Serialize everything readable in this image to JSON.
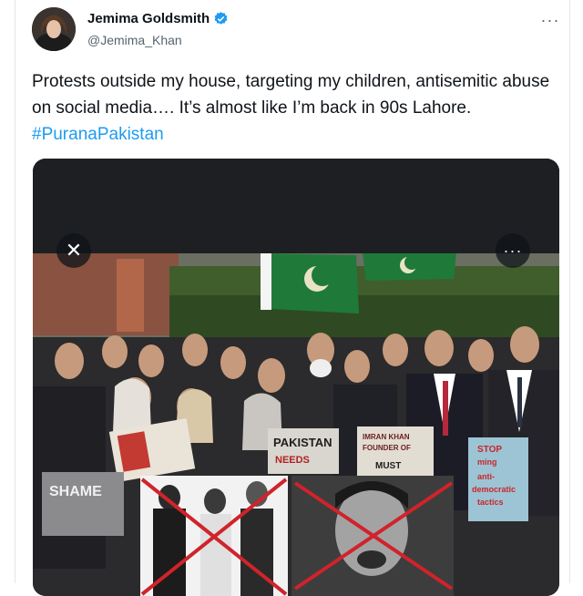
{
  "tweet": {
    "display_name": "Jemima Goldsmith",
    "handle": "@Jemima_Khan",
    "text_main": "Protests outside my house, targeting my children, antisemitic abuse on social media…. It’s almost like I’m back in 90s Lahore. ",
    "hashtag": "#PuranaPakistan",
    "more_icon": "···",
    "verified_icon": "verified-badge-icon"
  },
  "media": {
    "close_icon": "✕",
    "more_icon": "···",
    "signs": {
      "shame": "SHAME",
      "pakistan": "PAKISTAN",
      "needs": "NEEDS",
      "imran_line1": "IMRAN KHAN",
      "imran_line2": "FOUNDER OF",
      "imran_line3": "MUST",
      "stop_line1": "STOP",
      "stop_line2": "ming",
      "stop_line3": "anti-",
      "stop_line4": "democratic",
      "stop_line5": "tactics"
    }
  },
  "colors": {
    "text": "#0f1419",
    "secondary": "#536471",
    "link": "#1d9bf0",
    "flag_green": "#1f7a3a"
  }
}
